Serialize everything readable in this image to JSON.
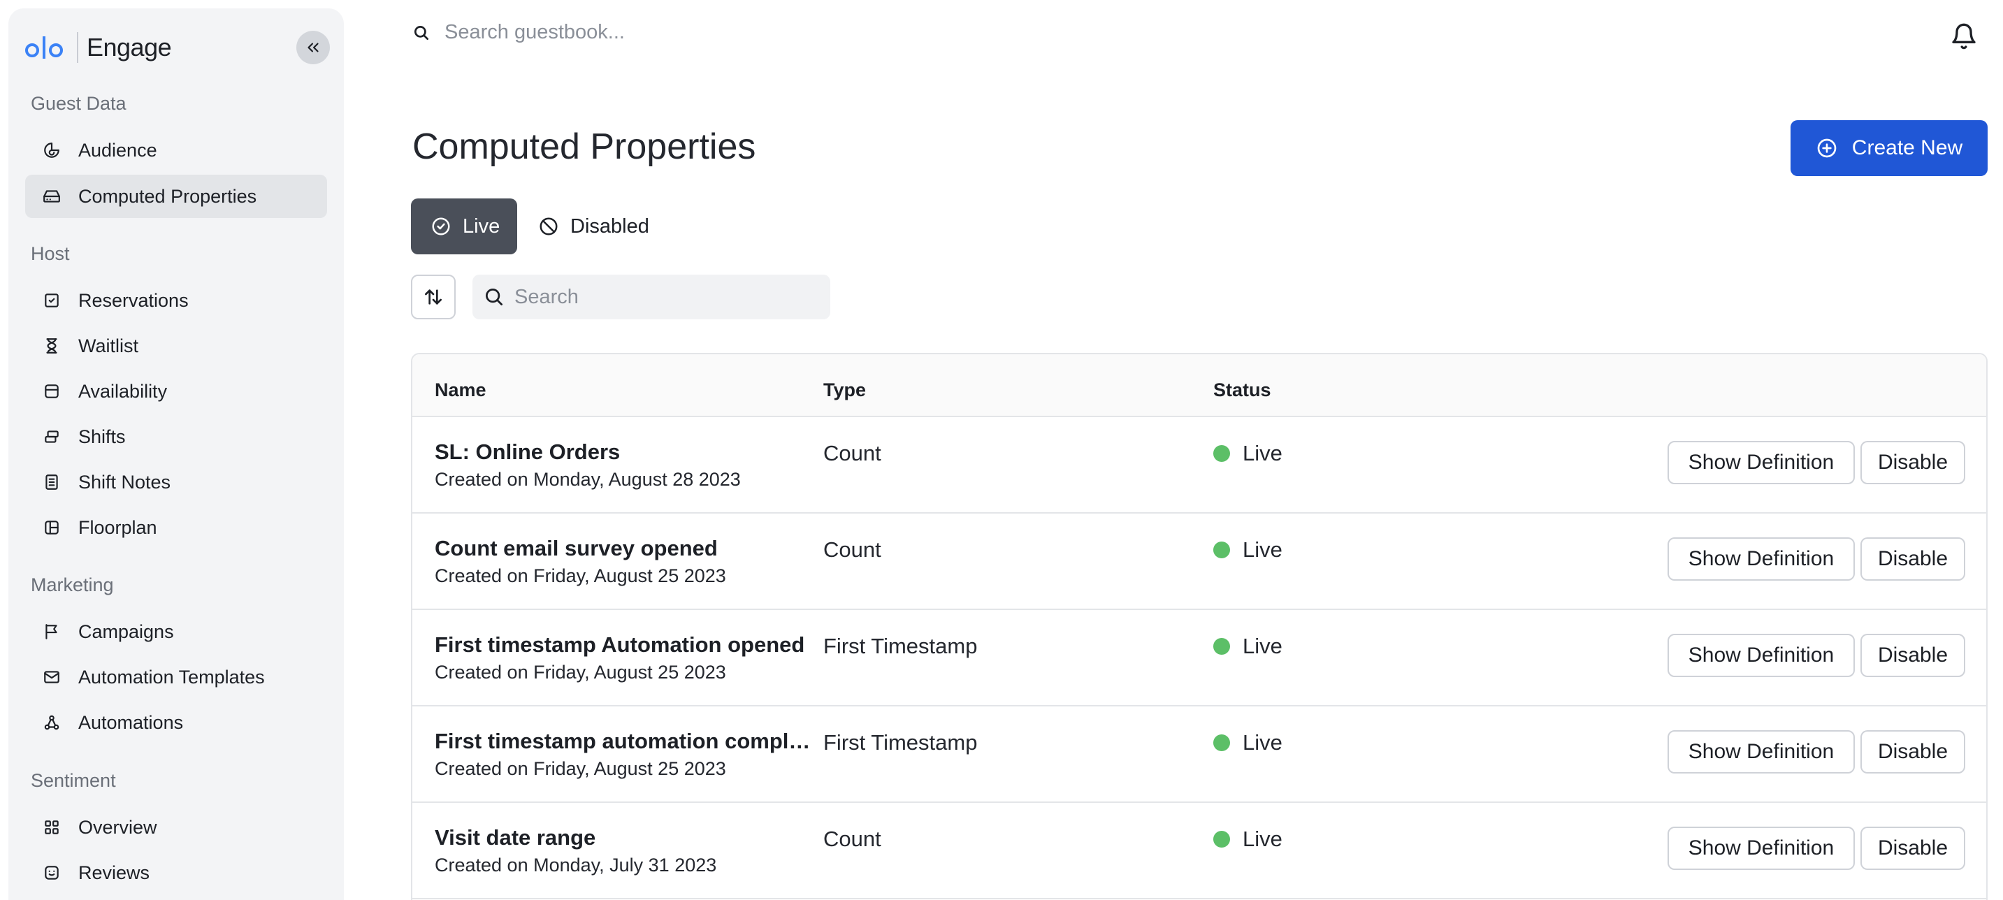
{
  "app": {
    "name": "Engage",
    "collapse_label": "«"
  },
  "sidebar": {
    "sections": [
      {
        "label": "Guest Data",
        "items": [
          {
            "label": "Audience",
            "icon": "pie-chart-icon"
          },
          {
            "label": "Computed Properties",
            "icon": "hard-drive-icon",
            "active": true
          }
        ]
      },
      {
        "label": "Host",
        "items": [
          {
            "label": "Reservations",
            "icon": "calendar-check-icon"
          },
          {
            "label": "Waitlist",
            "icon": "hourglass-icon"
          },
          {
            "label": "Availability",
            "icon": "database-icon"
          },
          {
            "label": "Shifts",
            "icon": "layers-icon"
          },
          {
            "label": "Shift Notes",
            "icon": "notes-icon"
          },
          {
            "label": "Floorplan",
            "icon": "floorplan-icon"
          }
        ]
      },
      {
        "label": "Marketing",
        "items": [
          {
            "label": "Campaigns",
            "icon": "flag-icon"
          },
          {
            "label": "Automation Templates",
            "icon": "mail-icon"
          },
          {
            "label": "Automations",
            "icon": "workflow-icon"
          }
        ]
      },
      {
        "label": "Sentiment",
        "items": [
          {
            "label": "Overview",
            "icon": "grid-icon"
          },
          {
            "label": "Reviews",
            "icon": "smiley-icon"
          }
        ]
      }
    ]
  },
  "topbar": {
    "search_placeholder": "Search guestbook..."
  },
  "page": {
    "title": "Computed Properties",
    "create_label": "Create New",
    "tabs": [
      {
        "label": "Live",
        "active": true
      },
      {
        "label": "Disabled",
        "active": false
      }
    ],
    "search_placeholder": "Search"
  },
  "table": {
    "columns": [
      "Name",
      "Type",
      "Status"
    ],
    "rows": [
      {
        "name": "SL: Online Orders",
        "created": "Created on Monday, August 28 2023",
        "type": "Count",
        "status": "Live"
      },
      {
        "name": "Count email survey opened",
        "created": "Created on Friday, August 25 2023",
        "type": "Count",
        "status": "Live"
      },
      {
        "name": "First timestamp Automation opened",
        "created": "Created on Friday, August 25 2023",
        "type": "First Timestamp",
        "status": "Live"
      },
      {
        "name": "First timestamp automation completed",
        "created": "Created on Friday, August 25 2023",
        "type": "First Timestamp",
        "status": "Live"
      },
      {
        "name": "Visit date range",
        "created": "Created on Monday, July 31 2023",
        "type": "Count",
        "status": "Live"
      }
    ],
    "show_definition_label": "Show Definition",
    "disable_label": "Disable"
  },
  "colors": {
    "primary": "#2057d6",
    "active_tab": "#4a4f59",
    "live_dot": "#5cbf67",
    "sidebar_bg": "#f3f4f6",
    "logo_blue": "#3b82f6"
  }
}
